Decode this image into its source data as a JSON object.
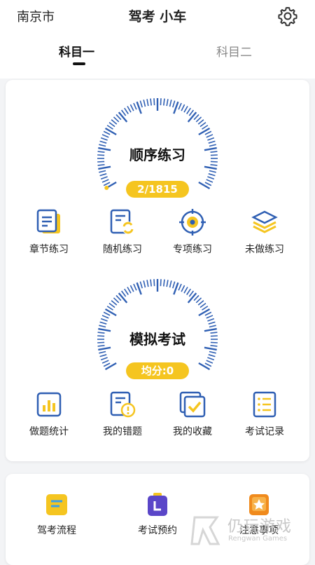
{
  "header": {
    "city": "南京市",
    "title": "驾考 小车",
    "tabs": [
      {
        "label": "科目一",
        "active": true
      },
      {
        "label": "科目二",
        "active": false
      }
    ]
  },
  "practice": {
    "gauge_title": "顺序练习",
    "progress": "2/1815",
    "items": [
      {
        "label": "章节练习",
        "icon": "document-icon"
      },
      {
        "label": "随机练习",
        "icon": "shuffle-document-icon"
      },
      {
        "label": "专项练习",
        "icon": "target-icon"
      },
      {
        "label": "未做练习",
        "icon": "layers-icon"
      }
    ]
  },
  "exam": {
    "gauge_title": "模拟考试",
    "average": "均分:0",
    "items": [
      {
        "label": "做题统计",
        "icon": "bar-chart-icon"
      },
      {
        "label": "我的错题",
        "icon": "error-document-icon"
      },
      {
        "label": "我的收藏",
        "icon": "favorites-icon"
      },
      {
        "label": "考试记录",
        "icon": "list-icon"
      }
    ]
  },
  "bottom": {
    "items": [
      {
        "label": "驾考流程",
        "icon": "process-icon"
      },
      {
        "label": "考试预约",
        "icon": "appointment-icon"
      },
      {
        "label": "注意事项",
        "icon": "notice-icon"
      }
    ]
  },
  "watermark": {
    "text": "仍玩游戏",
    "sub": "Rengwan Games"
  },
  "colors": {
    "accent": "#f5c520",
    "blue": "#2f5fb3",
    "card": "#ffffff"
  }
}
